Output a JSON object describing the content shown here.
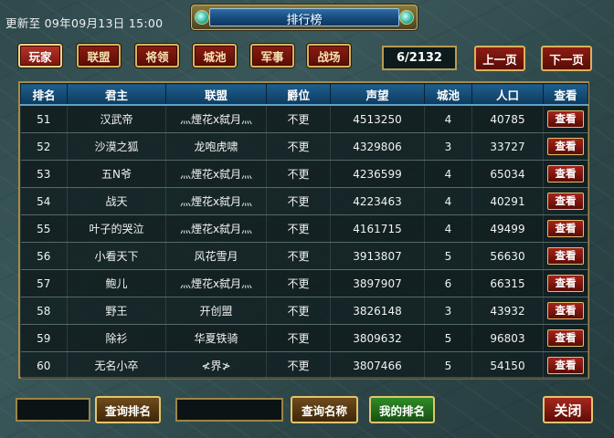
{
  "update_text": "更新至 09年09月13日 15:00",
  "title": "排行榜",
  "tabs": [
    {
      "label": "玩家",
      "active": true
    },
    {
      "label": "联盟",
      "active": false
    },
    {
      "label": "将领",
      "active": false
    },
    {
      "label": "城池",
      "active": false
    },
    {
      "label": "军事",
      "active": false
    },
    {
      "label": "战场",
      "active": false
    }
  ],
  "pagination": {
    "counter": "6/2132",
    "prev_label": "上一页",
    "next_label": "下一页"
  },
  "table": {
    "columns": [
      "排名",
      "君主",
      "联盟",
      "爵位",
      "声望",
      "城池",
      "人口",
      "查看"
    ],
    "view_label": "查看",
    "rows": [
      {
        "rank": "51",
        "lord": "汉武帝",
        "alliance": "灬煙花ⅹ弑月灬",
        "title": "不更",
        "prestige": "4513250",
        "cities": "4",
        "population": "40785"
      },
      {
        "rank": "52",
        "lord": "沙漠之狐",
        "alliance": "龙咆虎啸",
        "title": "不更",
        "prestige": "4329806",
        "cities": "3",
        "population": "33727"
      },
      {
        "rank": "53",
        "lord": "五N爷",
        "alliance": "灬煙花ⅹ弑月灬",
        "title": "不更",
        "prestige": "4236599",
        "cities": "4",
        "population": "65034"
      },
      {
        "rank": "54",
        "lord": "战天",
        "alliance": "灬煙花ⅹ弑月灬",
        "title": "不更",
        "prestige": "4223463",
        "cities": "4",
        "population": "40291"
      },
      {
        "rank": "55",
        "lord": "叶子的哭泣",
        "alliance": "灬煙花ⅹ弑月灬",
        "title": "不更",
        "prestige": "4161715",
        "cities": "4",
        "population": "49499"
      },
      {
        "rank": "56",
        "lord": "小看天下",
        "alliance": "风花雪月",
        "title": "不更",
        "prestige": "3913807",
        "cities": "5",
        "population": "56630"
      },
      {
        "rank": "57",
        "lord": "鲍儿",
        "alliance": "灬煙花ⅹ弑月灬",
        "title": "不更",
        "prestige": "3897907",
        "cities": "6",
        "population": "66315"
      },
      {
        "rank": "58",
        "lord": "野王",
        "alliance": "开创盟",
        "title": "不更",
        "prestige": "3826148",
        "cities": "3",
        "population": "43932"
      },
      {
        "rank": "59",
        "lord": "除衫",
        "alliance": "华夏铁骑",
        "title": "不更",
        "prestige": "3809632",
        "cities": "5",
        "population": "96803"
      },
      {
        "rank": "60",
        "lord": "无名小卒",
        "alliance": "≮界≯",
        "title": "不更",
        "prestige": "3807466",
        "cities": "5",
        "population": "54150"
      }
    ]
  },
  "footer": {
    "rank_input_value": "",
    "query_rank_label": "查询排名",
    "name_input_value": "",
    "query_name_label": "查询名称",
    "my_rank_label": "我的排名",
    "close_label": "关闭"
  }
}
